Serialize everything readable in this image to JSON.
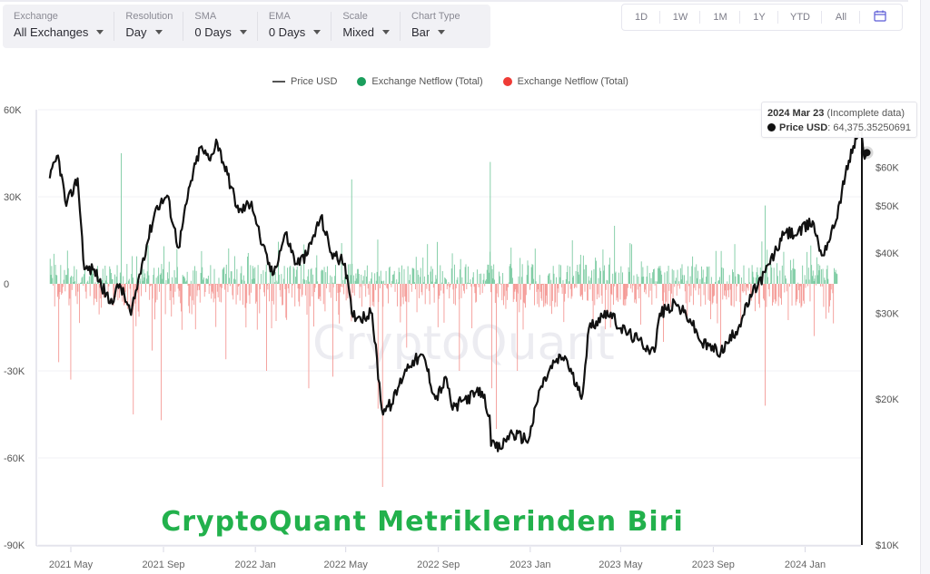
{
  "controls": [
    {
      "label": "Exchange",
      "value": "All Exchanges"
    },
    {
      "label": "Resolution",
      "value": "Day"
    },
    {
      "label": "SMA",
      "value": "0 Days"
    },
    {
      "label": "EMA",
      "value": "0 Days"
    },
    {
      "label": "Scale",
      "value": "Mixed"
    },
    {
      "label": "Chart Type",
      "value": "Bar"
    }
  ],
  "range_buttons": [
    "1D",
    "1W",
    "1M",
    "1Y",
    "YTD",
    "All"
  ],
  "calendar_icon": "calendar-icon",
  "colors": {
    "price": "#111111",
    "inflow_green": "#1a9e5c",
    "outflow_red": "#ef3b36",
    "bar_green": "#7ccba2",
    "bar_red": "#f49a96",
    "overlay_green": "#22b14c"
  },
  "watermark": "CryptoQuant",
  "overlay_caption": "CryptoQuant Metriklerinden Biri",
  "tooltip": {
    "date": "2024 Mar 23",
    "note": "(Incomplete data)",
    "series": "Price USD",
    "value": "64,375.35250691"
  },
  "chart_data": {
    "type": "bar",
    "title": "",
    "legend_position": "top-center",
    "legend": [
      {
        "name": "Price USD",
        "kind": "line",
        "color": "#555555"
      },
      {
        "name": "Exchange Netflow (Total)",
        "kind": "dot",
        "color": "#1a9e5c"
      },
      {
        "name": "Exchange Netflow (Total)",
        "kind": "dot",
        "color": "#ef3b36"
      }
    ],
    "x_ticks": [
      "2021 May",
      "2021 Sep",
      "2022 Jan",
      "2022 May",
      "2022 Sep",
      "2023 Jan",
      "2023 May",
      "2023 Sep",
      "2024 Jan"
    ],
    "x_range": [
      "2021-04-01",
      "2024-03-23"
    ],
    "y_left": {
      "label": "Exchange Netflow",
      "ticks": [
        "60K",
        "30K",
        "0",
        "-30K",
        "-60K",
        "-90K"
      ],
      "tick_values": [
        60000,
        30000,
        0,
        -30000,
        -60000,
        -90000
      ],
      "range": [
        -90000,
        60000
      ],
      "grid": true
    },
    "y_right": {
      "label": "Price USD",
      "scale": "log",
      "ticks": [
        "$60K",
        "$50K",
        "$40K",
        "$30K",
        "$20K",
        "$10K"
      ],
      "tick_values": [
        60000,
        50000,
        40000,
        30000,
        20000,
        10000
      ],
      "range": [
        10000,
        70000
      ]
    },
    "price_series": {
      "name": "Price USD",
      "months": [
        "2021-04",
        "2021-05",
        "2021-06",
        "2021-07",
        "2021-08",
        "2021-09",
        "2021-10",
        "2021-11",
        "2021-12",
        "2022-01",
        "2022-02",
        "2022-03",
        "2022-04",
        "2022-05",
        "2022-06",
        "2022-07",
        "2022-08",
        "2022-09",
        "2022-10",
        "2022-11",
        "2022-12",
        "2023-01",
        "2023-02",
        "2023-03",
        "2023-04",
        "2023-05",
        "2023-06",
        "2023-07",
        "2023-08",
        "2023-09",
        "2023-10",
        "2023-11",
        "2023-12",
        "2024-01",
        "2024-02",
        "2024-03"
      ],
      "points": [
        [
          "2021-04-03",
          57000
        ],
        [
          "2021-04-14",
          63500
        ],
        [
          "2021-04-25",
          50000
        ],
        [
          "2021-05-10",
          57000
        ],
        [
          "2021-05-19",
          37000
        ],
        [
          "2021-06-01",
          37000
        ],
        [
          "2021-06-22",
          31500
        ],
        [
          "2021-07-05",
          34500
        ],
        [
          "2021-07-20",
          29800
        ],
        [
          "2021-08-05",
          39000
        ],
        [
          "2021-08-22",
          49500
        ],
        [
          "2021-09-06",
          52500
        ],
        [
          "2021-09-21",
          41000
        ],
        [
          "2021-10-06",
          55000
        ],
        [
          "2021-10-20",
          66000
        ],
        [
          "2021-11-02",
          62000
        ],
        [
          "2021-11-10",
          68500
        ],
        [
          "2021-11-25",
          58000
        ],
        [
          "2021-12-10",
          48500
        ],
        [
          "2021-12-27",
          51000
        ],
        [
          "2022-01-10",
          41500
        ],
        [
          "2022-01-24",
          36000
        ],
        [
          "2022-02-10",
          44000
        ],
        [
          "2022-02-24",
          38000
        ],
        [
          "2022-03-10",
          39500
        ],
        [
          "2022-03-29",
          47500
        ],
        [
          "2022-04-12",
          40000
        ],
        [
          "2022-04-30",
          38000
        ],
        [
          "2022-05-09",
          30000
        ],
        [
          "2022-05-20",
          29500
        ],
        [
          "2022-06-05",
          30000
        ],
        [
          "2022-06-18",
          19000
        ],
        [
          "2022-07-01",
          19500
        ],
        [
          "2022-07-19",
          23000
        ],
        [
          "2022-07-29",
          24000
        ],
        [
          "2022-08-13",
          24400
        ],
        [
          "2022-08-28",
          20000
        ],
        [
          "2022-09-12",
          22000
        ],
        [
          "2022-09-20",
          19000
        ],
        [
          "2022-10-06",
          20000
        ],
        [
          "2022-10-29",
          20700
        ],
        [
          "2022-11-08",
          18500
        ],
        [
          "2022-11-10",
          16000
        ],
        [
          "2022-11-22",
          15800
        ],
        [
          "2022-12-05",
          17000
        ],
        [
          "2022-12-30",
          16500
        ],
        [
          "2023-01-14",
          21000
        ],
        [
          "2023-02-02",
          23800
        ],
        [
          "2023-02-16",
          24500
        ],
        [
          "2023-03-10",
          20000
        ],
        [
          "2023-03-20",
          28000
        ],
        [
          "2023-04-13",
          30400
        ],
        [
          "2023-05-01",
          28000
        ],
        [
          "2023-05-25",
          26400
        ],
        [
          "2023-06-15",
          25000
        ],
        [
          "2023-06-22",
          30000
        ],
        [
          "2023-07-13",
          31400
        ],
        [
          "2023-08-01",
          29200
        ],
        [
          "2023-08-17",
          26000
        ],
        [
          "2023-09-11",
          25000
        ],
        [
          "2023-10-01",
          27500
        ],
        [
          "2023-10-23",
          33000
        ],
        [
          "2023-11-09",
          36500
        ],
        [
          "2023-12-05",
          44000
        ],
        [
          "2023-12-22",
          43800
        ],
        [
          "2024-01-11",
          46500
        ],
        [
          "2024-01-23",
          39500
        ],
        [
          "2024-02-08",
          45000
        ],
        [
          "2024-02-28",
          62000
        ],
        [
          "2024-03-14",
          73000
        ],
        [
          "2024-03-20",
          62500
        ],
        [
          "2024-03-23",
          64375.35
        ]
      ]
    },
    "netflow_series": {
      "name": "Exchange Netflow (Total)",
      "note": "daily bars; green = positive (inflow), red = negative (outflow); notable spikes listed",
      "notable_spikes": [
        [
          "2021-04-14",
          -27000
        ],
        [
          "2021-04-30",
          -33000
        ],
        [
          "2021-07-06",
          45000
        ],
        [
          "2021-07-22",
          -45000
        ],
        [
          "2021-08-16",
          -23000
        ],
        [
          "2021-08-28",
          -47000
        ],
        [
          "2021-09-18",
          12000
        ],
        [
          "2021-11-22",
          -26000
        ],
        [
          "2022-01-15",
          -30000
        ],
        [
          "2022-03-12",
          -36000
        ],
        [
          "2022-04-13",
          -32000
        ],
        [
          "2022-05-08",
          36000
        ],
        [
          "2022-06-12",
          -43000
        ],
        [
          "2022-06-18",
          -70000
        ],
        [
          "2022-07-20",
          -22000
        ],
        [
          "2022-09-28",
          -30000
        ],
        [
          "2022-11-08",
          42000
        ],
        [
          "2022-11-10",
          -36000
        ],
        [
          "2022-11-16",
          -50000
        ],
        [
          "2022-12-14",
          -30000
        ],
        [
          "2023-02-25",
          15000
        ],
        [
          "2023-03-08",
          10000
        ],
        [
          "2023-04-22",
          20000
        ],
        [
          "2023-06-26",
          -20000
        ],
        [
          "2023-09-10",
          -22000
        ],
        [
          "2023-11-08",
          27000
        ],
        [
          "2023-11-08",
          -42000
        ],
        [
          "2024-01-12",
          -18000
        ],
        [
          "2024-02-24",
          -18000
        ]
      ],
      "typical_range": [
        -15000,
        12000
      ]
    }
  }
}
